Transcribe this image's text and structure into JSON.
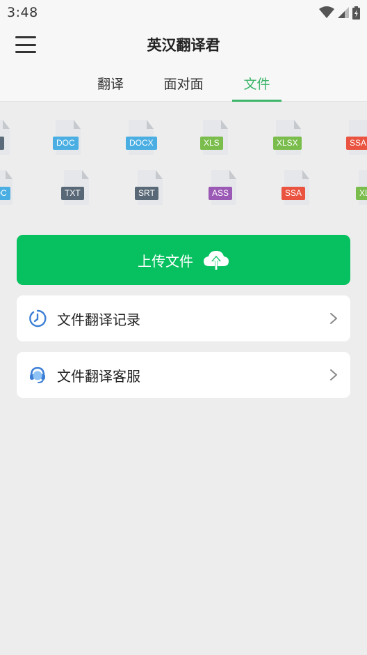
{
  "status_bar": {
    "time": "3:48"
  },
  "header": {
    "title": "英汉翻译君"
  },
  "tabs": [
    {
      "label": "翻译",
      "active": false
    },
    {
      "label": "面对面",
      "active": false
    },
    {
      "label": "文件",
      "active": true
    }
  ],
  "file_types": {
    "row1": [
      {
        "label": "",
        "color": "#5a6a7a"
      },
      {
        "label": "DOC",
        "color": "#4aaee3"
      },
      {
        "label": "DOCX",
        "color": "#4aaee3"
      },
      {
        "label": "XLS",
        "color": "#7bbd4d"
      },
      {
        "label": "XLSX",
        "color": "#7bbd4d"
      },
      {
        "label": "SSA",
        "color": "#e9533f"
      }
    ],
    "row2": [
      {
        "label": "DOC",
        "color": "#4aaee3"
      },
      {
        "label": "TXT",
        "color": "#596877"
      },
      {
        "label": "SRT",
        "color": "#596877"
      },
      {
        "label": "ASS",
        "color": "#9b59b6"
      },
      {
        "label": "SSA",
        "color": "#e9533f"
      },
      {
        "label": "XLS",
        "color": "#7bbd4d"
      }
    ]
  },
  "upload": {
    "label": "上传文件"
  },
  "menu_items": [
    {
      "label": "文件翻译记录",
      "icon": "clock-icon"
    },
    {
      "label": "文件翻译客服",
      "icon": "customer-service-icon"
    }
  ],
  "colors": {
    "accent": "#3cb56a",
    "primary_button": "#07c160"
  }
}
